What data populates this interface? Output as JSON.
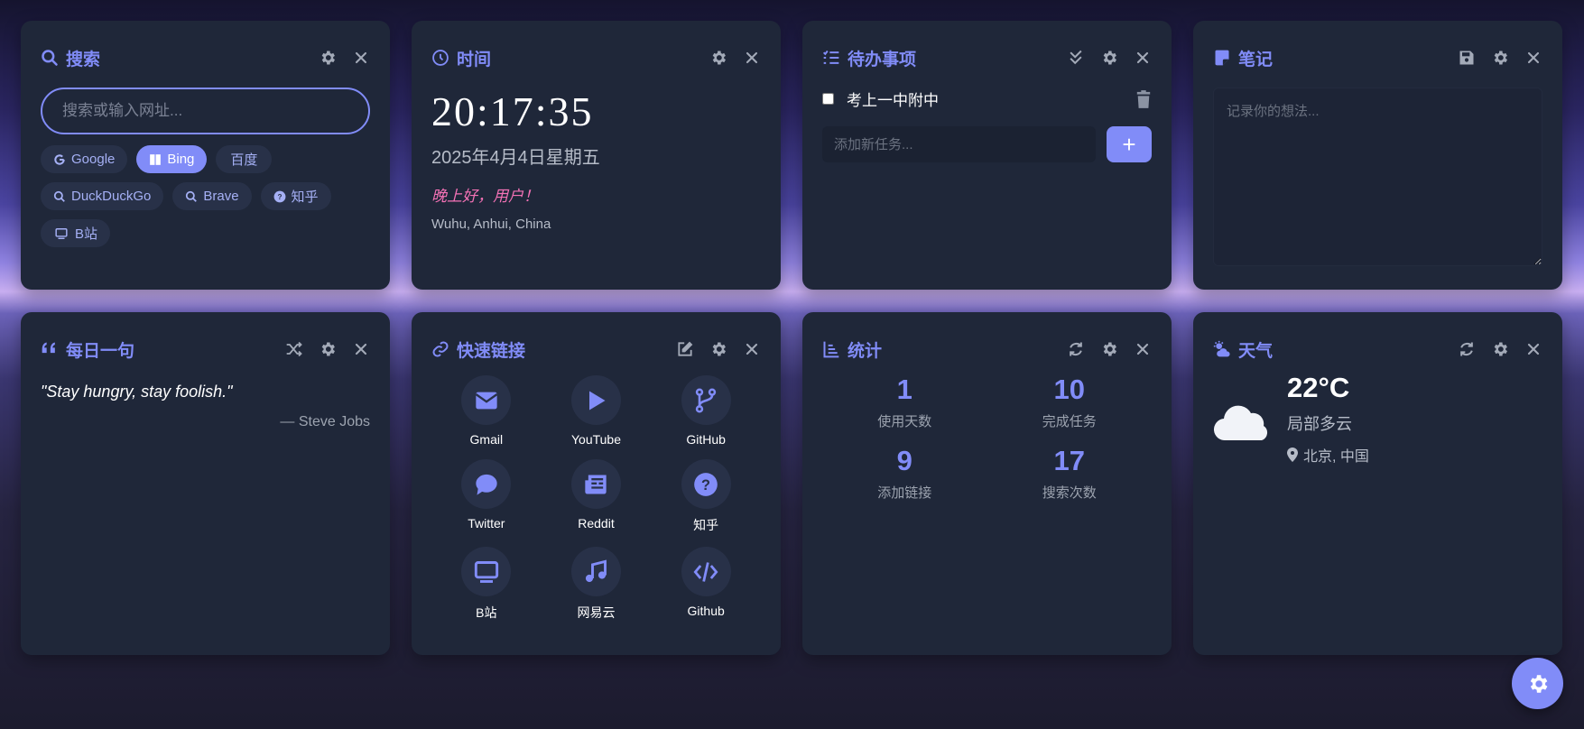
{
  "search": {
    "title": "搜索",
    "placeholder": "搜索或输入网址...",
    "engines": [
      "Google",
      "Bing",
      "百度",
      "DuckDuckGo",
      "Brave",
      "知乎",
      "B站"
    ],
    "active_engine": "Bing"
  },
  "time": {
    "title": "时间",
    "clock": "20:17:35",
    "date": "2025年4月4日星期五",
    "greeting": "晚上好，用户！",
    "location": "Wuhu, Anhui, China"
  },
  "todo": {
    "title": "待办事项",
    "items": [
      {
        "text": "考上一中附中",
        "done": false
      }
    ],
    "placeholder": "添加新任务...",
    "add_label": "+"
  },
  "notes": {
    "title": "笔记",
    "placeholder": "记录你的想法..."
  },
  "quote": {
    "title": "每日一句",
    "text": "\"Stay hungry, stay foolish.\"",
    "author": "— Steve Jobs"
  },
  "links": {
    "title": "快速链接",
    "items": [
      {
        "label": "Gmail",
        "icon": "envelope-icon"
      },
      {
        "label": "YouTube",
        "icon": "play-icon"
      },
      {
        "label": "GitHub",
        "icon": "code-branch-icon"
      },
      {
        "label": "Twitter",
        "icon": "comment-icon"
      },
      {
        "label": "Reddit",
        "icon": "newspaper-icon"
      },
      {
        "label": "知乎",
        "icon": "question-circle-icon"
      },
      {
        "label": "B站",
        "icon": "tv-icon"
      },
      {
        "label": "网易云",
        "icon": "music-icon"
      },
      {
        "label": "Github",
        "icon": "code-icon"
      }
    ]
  },
  "stats": {
    "title": "统计",
    "items": [
      {
        "value": "1",
        "label": "使用天数"
      },
      {
        "value": "10",
        "label": "完成任务"
      },
      {
        "value": "9",
        "label": "添加链接"
      },
      {
        "value": "17",
        "label": "搜索次数"
      }
    ]
  },
  "weather": {
    "title": "天气",
    "temp": "22°C",
    "condition": "局部多云",
    "location": "北京, 中国"
  },
  "colors": {
    "accent": "#818cf8",
    "card": "#1f2739",
    "greeting": "#f472b6"
  }
}
